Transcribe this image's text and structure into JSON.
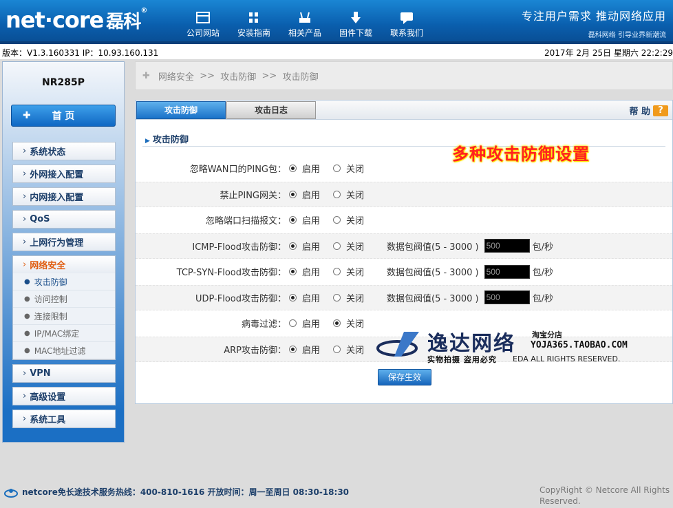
{
  "header": {
    "logo_text": "net·core",
    "logo_cn": "磊科",
    "logo_reg": "®",
    "nav": [
      {
        "label": "公司网站",
        "icon": "website-icon"
      },
      {
        "label": "安装指南",
        "icon": "install-guide-icon"
      },
      {
        "label": "相关产品",
        "icon": "products-icon"
      },
      {
        "label": "固件下载",
        "icon": "download-icon"
      },
      {
        "label": "联系我们",
        "icon": "contact-icon"
      }
    ],
    "slogan_main": "专注用户需求   推动网络应用",
    "slogan_sub": "磊科网络 引导业界新潮流"
  },
  "infobar": {
    "version": "版本：V1.3.160331   IP：10.93.160.131",
    "datetime": "2017年 2月 25日 星期六 22:2:29"
  },
  "sidebar": {
    "model": "NR285P",
    "home": "首   页",
    "menu": [
      {
        "label": "系统状态"
      },
      {
        "label": "外网接入配置"
      },
      {
        "label": "内网接入配置"
      },
      {
        "label": "QoS"
      },
      {
        "label": "上网行为管理"
      },
      {
        "label": "网络安全"
      }
    ],
    "submenu": [
      "攻击防御",
      "访问控制",
      "连接限制",
      "IP/MAC绑定",
      "MAC地址过滤"
    ],
    "menu_after": [
      "VPN",
      "高级设置",
      "系统工具"
    ]
  },
  "breadcrumb": {
    "items": [
      "网络安全",
      ">>",
      "攻击防御",
      ">>",
      "攻击防御"
    ]
  },
  "tabs": {
    "active": "攻击防御",
    "inactive": "攻击日志",
    "help": "帮 助",
    "help_q": "?"
  },
  "section": {
    "title": "攻击防御",
    "promo": "多种攻击防御设置"
  },
  "rows": [
    {
      "label": "忽略WAN口的PING包：",
      "on": "启用",
      "off": "关闭",
      "selected": "on"
    },
    {
      "label": "禁止PING网关：",
      "on": "启用",
      "off": "关闭",
      "selected": "on"
    },
    {
      "label": "忽略端口扫描报文：",
      "on": "启用",
      "off": "关闭",
      "selected": "on"
    },
    {
      "label": "ICMP-Flood攻击防御：",
      "on": "启用",
      "off": "关闭",
      "selected": "on",
      "threshold_label": "数据包阀值(5 - 3000 )",
      "threshold_value": "500",
      "unit": "包/秒"
    },
    {
      "label": "TCP-SYN-Flood攻击防御：",
      "on": "启用",
      "off": "关闭",
      "selected": "on",
      "threshold_label": "数据包阀值(5 - 3000 )",
      "threshold_value": "500",
      "unit": "包/秒"
    },
    {
      "label": "UDP-Flood攻击防御：",
      "on": "启用",
      "off": "关闭",
      "selected": "on",
      "threshold_label": "数据包阀值(5 - 3000 )",
      "threshold_value": "500",
      "unit": "包/秒"
    },
    {
      "label": "病毒过滤：",
      "on": "启用",
      "off": "关闭",
      "selected": "off"
    },
    {
      "label": "ARP攻击防御：",
      "on": "启用",
      "off": "关闭",
      "selected": "on"
    }
  ],
  "save_label": "保存生效",
  "watermark": {
    "name": "逸达网络",
    "shop": "淘宝分店",
    "url": "YOJA365.TAOBAO.COM",
    "sub": "实物拍摄 盗用必究",
    "rights": "EDA  ALL RIGHTS RESERVED."
  },
  "footer": {
    "hotline": "netcore免长途技术服务热线：400-810-1616   开放时间：周一至周日 08:30-18:30",
    "copyright": "CopyRight © Netcore All Rights Reserved."
  }
}
